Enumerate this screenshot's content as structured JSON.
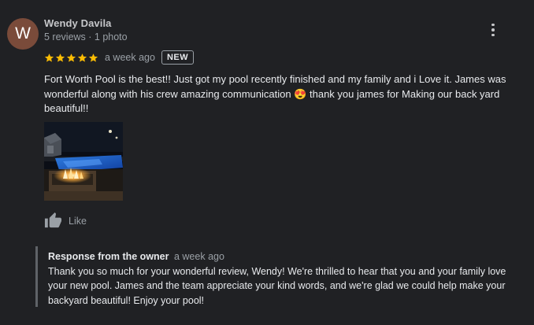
{
  "reviewer": {
    "avatar_initial": "W",
    "name": "Wendy Davila",
    "meta": "5 reviews · 1 photo"
  },
  "review": {
    "rating": 5,
    "time_ago": "a week ago",
    "badge": "NEW",
    "text": "Fort Worth Pool is the best!! Just got my pool recently finished and my family and i Love it. James was wonderful along with his crew amazing communication 😍  thank you james for Making our back yard beautiful!!",
    "photo_count": 1
  },
  "actions": {
    "like_label": "Like"
  },
  "owner_response": {
    "title": "Response from the owner",
    "time_ago": "a week ago",
    "text": "Thank you so much for your wonderful review, Wendy! We're thrilled to hear that you and your family love your new pool. James and the team appreciate your kind words, and we're glad we could help make your backyard beautiful! Enjoy your pool!"
  },
  "colors": {
    "background": "#202124",
    "star": "#fbbc04",
    "avatar": "#7a4b3a",
    "primary_text": "#e8eaed",
    "secondary_text": "#9aa0a6"
  },
  "icons": {
    "menu": "more-vert-icon",
    "star": "star-icon",
    "like": "thumb-up-icon"
  }
}
